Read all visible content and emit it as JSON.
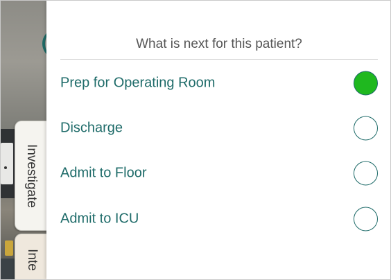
{
  "tabs": [
    {
      "label": "Investigate"
    },
    {
      "label": "Inte"
    }
  ],
  "dialog": {
    "question": "What is next for this patient?",
    "options": [
      {
        "label": "Prep for Operating Room",
        "selected": true
      },
      {
        "label": "Discharge",
        "selected": false
      },
      {
        "label": "Admit to Floor",
        "selected": false
      },
      {
        "label": "Admit to ICU",
        "selected": false
      }
    ]
  },
  "colors": {
    "accent_text": "#1e6b69",
    "selected_fill": "#1fb81f",
    "question_text": "#555555"
  }
}
